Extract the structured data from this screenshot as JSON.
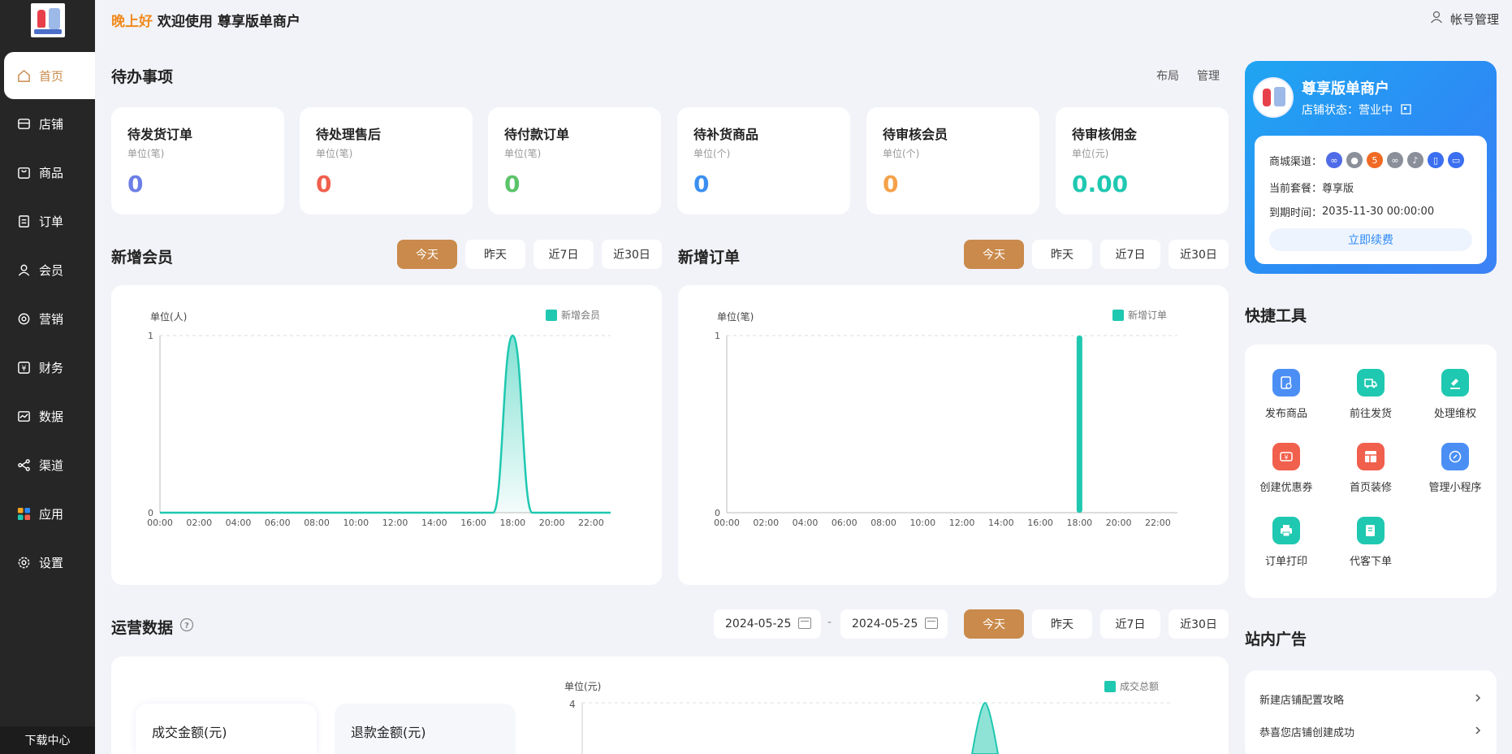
{
  "sidebar": {
    "items": [
      {
        "label": "首页",
        "icon": "home-icon"
      },
      {
        "label": "店铺",
        "icon": "store-icon"
      },
      {
        "label": "商品",
        "icon": "bag-icon"
      },
      {
        "label": "订单",
        "icon": "order-icon"
      },
      {
        "label": "会员",
        "icon": "user-icon"
      },
      {
        "label": "营销",
        "icon": "marketing-icon"
      },
      {
        "label": "财务",
        "icon": "yen-icon"
      },
      {
        "label": "数据",
        "icon": "data-icon"
      },
      {
        "label": "渠道",
        "icon": "channel-icon"
      },
      {
        "label": "应用",
        "icon": "apps-icon"
      },
      {
        "label": "设置",
        "icon": "settings-icon"
      }
    ],
    "download": "下载中心"
  },
  "header": {
    "greeting": "晚上好",
    "welcome": "欢迎使用 尊享版单商户",
    "account": "帐号管理"
  },
  "todo": {
    "title": "待办事项",
    "layout_link": "布局",
    "manage_link": "管理",
    "cards": [
      {
        "title": "待发货订单",
        "unit": "单位(笔)",
        "value": "0",
        "color": "#6c7ee6"
      },
      {
        "title": "待处理售后",
        "unit": "单位(笔)",
        "value": "0",
        "color": "#f0604d"
      },
      {
        "title": "待付款订单",
        "unit": "单位(笔)",
        "value": "0",
        "color": "#5bc46a"
      },
      {
        "title": "待补货商品",
        "unit": "单位(个)",
        "value": "0",
        "color": "#3b8ff0"
      },
      {
        "title": "待审核会员",
        "unit": "单位(个)",
        "value": "0",
        "color": "#f5a14a"
      },
      {
        "title": "待审核佣金",
        "unit": "单位(元)",
        "value": "0.00",
        "color": "#1fc8b0"
      }
    ]
  },
  "ranges": [
    "今天",
    "昨天",
    "近7日",
    "近30日"
  ],
  "members": {
    "title": "新增会员",
    "unit": "单位(人)",
    "legend": "新增会员"
  },
  "orders": {
    "title": "新增订单",
    "unit": "单位(笔)",
    "legend": "新增订单"
  },
  "ops": {
    "title": "运营数据",
    "date_from": "2024-05-25",
    "date_sep": "-",
    "date_to": "2024-05-25",
    "mini1": "成交金额(元)",
    "mini2": "退款金额(元)",
    "unit": "单位(元)",
    "legend": "成交总额",
    "ytop": "4"
  },
  "store": {
    "name": "尊享版单商户",
    "status_label": "店铺状态：",
    "status_value": "营业中",
    "channels_label": "商城渠道：",
    "plan_label": "当前套餐：",
    "plan_value": "尊享版",
    "expire_label": "到期时间：",
    "expire_value": "2035-11-30 00:00:00",
    "renew": "立即续费",
    "channel_colors": [
      "#4f6be8",
      "#8a8f99",
      "#f06a24",
      "#8a8f99",
      "#8a8f99",
      "#3b6ff0",
      "#3b6ff0"
    ]
  },
  "tools": {
    "title": "快捷工具",
    "items": [
      {
        "label": "发布商品",
        "color": "#4b8ff5",
        "icon": "publish-icon"
      },
      {
        "label": "前往发货",
        "color": "#1fc8b0",
        "icon": "truck-icon"
      },
      {
        "label": "处理维权",
        "color": "#1fc8b0",
        "icon": "gavel-icon"
      },
      {
        "label": "创建优惠券",
        "color": "#f0604d",
        "icon": "coupon-icon"
      },
      {
        "label": "首页装修",
        "color": "#f0604d",
        "icon": "layout-icon"
      },
      {
        "label": "管理小程序",
        "color": "#4b8ff5",
        "icon": "miniprogram-icon"
      },
      {
        "label": "订单打印",
        "color": "#1fc8b0",
        "icon": "printer-icon"
      },
      {
        "label": "代客下单",
        "color": "#1fc8b0",
        "icon": "cart-order-icon"
      }
    ]
  },
  "ads": {
    "title": "站内广告",
    "items": [
      "新建店铺配置攻略",
      "恭喜您店铺创建成功"
    ]
  },
  "chart_data": [
    {
      "type": "area",
      "title": "新增会员",
      "ylabel": "单位(人)",
      "x": [
        "00:00",
        "01:00",
        "02:00",
        "03:00",
        "04:00",
        "05:00",
        "06:00",
        "07:00",
        "08:00",
        "09:00",
        "10:00",
        "11:00",
        "12:00",
        "13:00",
        "14:00",
        "15:00",
        "16:00",
        "17:00",
        "18:00",
        "19:00",
        "20:00",
        "21:00",
        "22:00",
        "23:00"
      ],
      "xticks": [
        "00:00",
        "02:00",
        "04:00",
        "06:00",
        "08:00",
        "10:00",
        "12:00",
        "14:00",
        "16:00",
        "18:00",
        "20:00",
        "22:00"
      ],
      "series": [
        {
          "name": "新增会员",
          "values": [
            0,
            0,
            0,
            0,
            0,
            0,
            0,
            0,
            0,
            0,
            0,
            0,
            0,
            0,
            0,
            0,
            0,
            0,
            1,
            0,
            0,
            0,
            0,
            0
          ]
        }
      ],
      "ylim": [
        0,
        1
      ],
      "yticks": [
        "0",
        "1"
      ]
    },
    {
      "type": "bar",
      "title": "新增订单",
      "ylabel": "单位(笔)",
      "x": [
        "00:00",
        "01:00",
        "02:00",
        "03:00",
        "04:00",
        "05:00",
        "06:00",
        "07:00",
        "08:00",
        "09:00",
        "10:00",
        "11:00",
        "12:00",
        "13:00",
        "14:00",
        "15:00",
        "16:00",
        "17:00",
        "18:00",
        "19:00",
        "20:00",
        "21:00",
        "22:00",
        "23:00"
      ],
      "xticks": [
        "00:00",
        "02:00",
        "04:00",
        "06:00",
        "08:00",
        "10:00",
        "12:00",
        "14:00",
        "16:00",
        "18:00",
        "20:00",
        "22:00"
      ],
      "series": [
        {
          "name": "新增订单",
          "values": [
            0,
            0,
            0,
            0,
            0,
            0,
            0,
            0,
            0,
            0,
            0,
            0,
            0,
            0,
            0,
            0,
            0,
            0,
            1,
            0,
            0,
            0,
            0,
            0
          ]
        }
      ],
      "ylim": [
        0,
        1
      ],
      "yticks": [
        "0",
        "1"
      ]
    }
  ]
}
